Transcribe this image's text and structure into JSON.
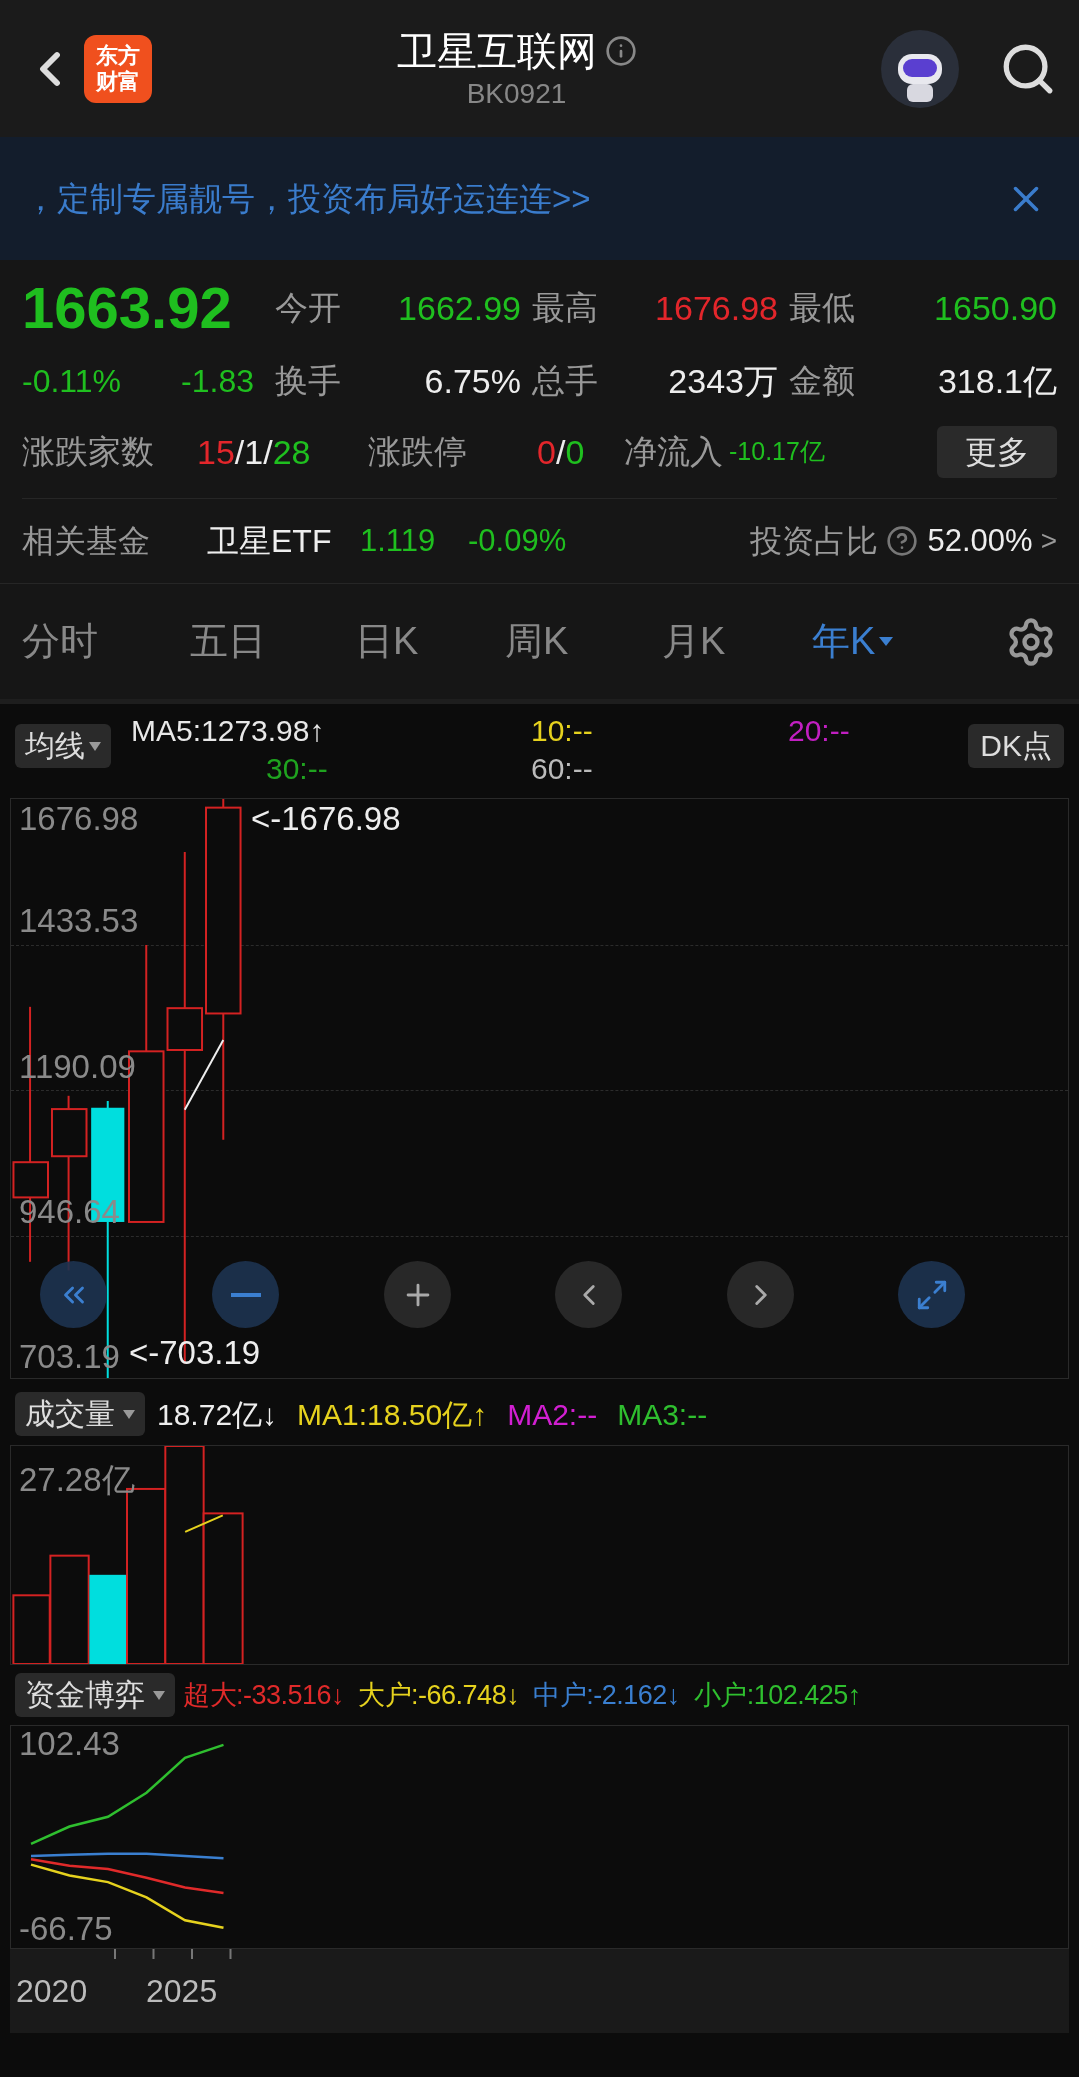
{
  "header": {
    "logo_lines": [
      "东方",
      "财富"
    ],
    "title": "卫星互联网",
    "code": "BK0921"
  },
  "banner": {
    "text": "，定制专属靓号，投资布局好运连连>>"
  },
  "quote": {
    "price": "1663.92",
    "color": "#1fbf1f",
    "change_pct": "-0.11%",
    "change": "-1.83",
    "stats": [
      {
        "label": "今开",
        "value": "1662.99",
        "color": "#1fbf1f"
      },
      {
        "label": "最高",
        "value": "1676.98",
        "color": "#e3262b"
      },
      {
        "label": "最低",
        "value": "1650.90",
        "color": "#1fbf1f"
      },
      {
        "label": "换手",
        "value": "6.75%",
        "color": "#eeeeee"
      },
      {
        "label": "总手",
        "value": "2343万",
        "color": "#eeeeee"
      },
      {
        "label": "金额",
        "value": "318.1亿",
        "color": "#eeeeee"
      }
    ],
    "breadth": {
      "label": "涨跌家数",
      "parts": [
        {
          "text": "15",
          "color": "#e3262b"
        },
        {
          "text": "/1/",
          "color": "#eeeeee"
        },
        {
          "text": "28",
          "color": "#1fbf1f"
        }
      ]
    },
    "limits": {
      "label": "涨跌停",
      "parts": [
        {
          "text": "0",
          "color": "#e3262b"
        },
        {
          "text": "/",
          "color": "#eeeeee"
        },
        {
          "text": "0",
          "color": "#1fbf1f"
        }
      ]
    },
    "net_inflow": {
      "label": "净流入",
      "value": "-10.17亿"
    },
    "more_button": "更多"
  },
  "fund": {
    "label": "相关基金",
    "name": "卫星ETF",
    "price": "1.119",
    "change": "-0.09%",
    "ratio_label": "投资占比",
    "ratio": "52.00%",
    "chevron": ">"
  },
  "tabs": [
    {
      "label": "分时",
      "selected": false
    },
    {
      "label": "五日",
      "selected": false
    },
    {
      "label": "日K",
      "selected": false
    },
    {
      "label": "周K",
      "selected": false
    },
    {
      "label": "月K",
      "selected": false
    },
    {
      "label": "年K",
      "selected": true
    }
  ],
  "ma": {
    "selector": "均线",
    "items": [
      {
        "text": "MA5:1273.98↑",
        "color": "#e8e8e8"
      },
      {
        "text": "10:--",
        "color": "#e6d21e"
      },
      {
        "text": "20:--",
        "color": "#c21fc2"
      },
      {
        "text": "30:--",
        "color": "#1fa31f"
      },
      {
        "text": "60:--",
        "color": "#bbbbbb"
      }
    ],
    "dk_button": "DK点"
  },
  "kline": {
    "axis_labels": [
      "1676.98",
      "1433.53",
      "1190.09",
      "946.64",
      "703.19"
    ],
    "high_marker": "<-1676.98",
    "low_marker": "<-703.19"
  },
  "volume": {
    "selector": "成交量",
    "legend": [
      {
        "text": "18.72亿↓",
        "color": "#eeeeee"
      },
      {
        "text": "MA1:18.50亿↑",
        "color": "#e6d21e"
      },
      {
        "text": "MA2:--",
        "color": "#d21fd2"
      },
      {
        "text": "MA3:--",
        "color": "#2fbf2f"
      }
    ],
    "axis_label": "27.28亿"
  },
  "money_flow": {
    "selector": "资金博弈",
    "legend": [
      "超大:-33.516↓",
      "大户:-66.748↓",
      "中户:-2.162↓",
      "小户:102.425↑"
    ],
    "chart_data": {
      "type": "line",
      "ylim": [
        -84.5,
        119.3
      ],
      "yticks": [
        {
          "value": 102.43,
          "label": "102.43"
        },
        {
          "value": -66.75,
          "label": "-66.75"
        }
      ],
      "series": [
        {
          "color": "#e02a2a",
          "values": [
            -3,
            -9,
            -12,
            -20,
            -29,
            -34
          ]
        },
        {
          "color": "#e6d21e",
          "values": [
            -8,
            -18,
            -24,
            -38,
            -59,
            -66
          ]
        },
        {
          "color": "#3a7fd0",
          "values": [
            0,
            1,
            2,
            2,
            0,
            -2
          ]
        },
        {
          "color": "#2fbf2f",
          "values": [
            11,
            27,
            36,
            58,
            90,
            102
          ]
        }
      ]
    },
    "time_axis": [
      "2020",
      "2025"
    ]
  }
}
